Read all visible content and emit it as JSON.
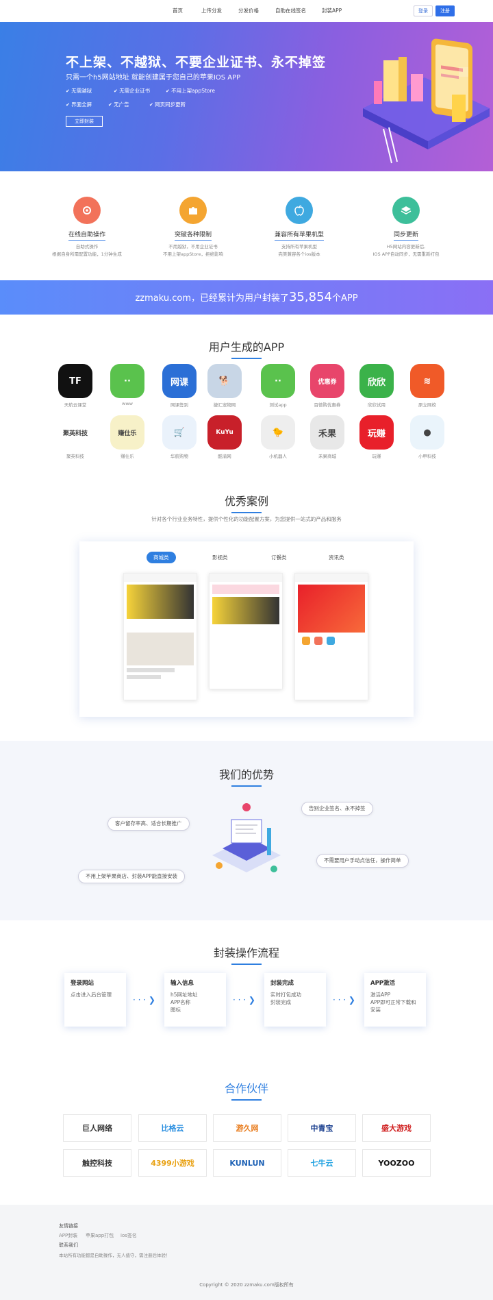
{
  "nav": {
    "links": [
      "首页",
      "上传分发",
      "分发价格",
      "自助在线签名",
      "封装APP"
    ],
    "login": "登录",
    "register": "注册"
  },
  "hero": {
    "title": "不上架、不越狱、不要企业证书、永不掉签",
    "subtitle": "只需一个h5网站地址 就能创建属于您自己的苹果IOS APP",
    "features": [
      "无需越狱",
      "无需企业证书",
      "不用上架appStore",
      "界面全屏",
      "无广告",
      "网页同步更新"
    ],
    "button": "立即封装"
  },
  "features": [
    {
      "title": "在线自助操作",
      "desc1": "自助式操作",
      "desc2": "根据自身所需配置功能，1分钟生成",
      "color": "#f2725a",
      "icon": "gear-icon"
    },
    {
      "title": "突破各种限制",
      "desc1": "不用越狱，不用企业证书",
      "desc2": "不用上架appStore，拒绝影响",
      "color": "#f4a531",
      "icon": "puzzle-icon"
    },
    {
      "title": "兼容所有苹果机型",
      "desc1": "支持所有苹果机型",
      "desc2": "完美兼容各个ios版本",
      "color": "#3fa9e0",
      "icon": "apple-icon"
    },
    {
      "title": "同步更新",
      "desc1": "H5网站内容更新后,",
      "desc2": "IOS APP自动同步，无需重新打包",
      "color": "#3dbf9a",
      "icon": "layers-icon"
    }
  ],
  "banner": {
    "prefix": "zzmaku.com，已经累计为用户封装了",
    "count": "35,854",
    "suffix": "个APP"
  },
  "apps_section": {
    "title": "用户生成的APP",
    "apps": [
      {
        "name": "天航云课堂",
        "text": "TF",
        "bg": "#111"
      },
      {
        "name": "www",
        "text": "··",
        "bg": "#5ac24d"
      },
      {
        "name": "网课签到",
        "text": "网课",
        "bg": "#2b6fd6"
      },
      {
        "name": "捷汇宠物网",
        "text": "🐕",
        "bg": "#c8d6e6"
      },
      {
        "name": "测试app",
        "text": "··",
        "bg": "#5ac24d"
      },
      {
        "name": "百德购优惠券",
        "text": "优惠券",
        "bg": "#e8456b"
      },
      {
        "name": "欣欣试用",
        "text": "欣欣",
        "bg": "#3bb24a"
      },
      {
        "name": "原立网校",
        "text": "≋",
        "bg": "#f05a28"
      },
      {
        "name": "聚英科技",
        "text": "聚英科技",
        "bg": "#fff"
      },
      {
        "name": "赚仕乐",
        "text": "赚仕乐",
        "bg": "#f7f1c8"
      },
      {
        "name": "华航购物",
        "text": "🛒",
        "bg": "#eaf2fb"
      },
      {
        "name": "酷渝网",
        "text": "KuYu",
        "bg": "#c8202a"
      },
      {
        "name": "小机器人",
        "text": "🐤",
        "bg": "#eeeeee"
      },
      {
        "name": "禾果商城",
        "text": "禾果",
        "bg": "#e8e8e8"
      },
      {
        "name": "玩赚",
        "text": "玩赚",
        "bg": "#e8202a"
      },
      {
        "name": "小甲科技",
        "text": "●",
        "bg": "#eaf4fb"
      }
    ]
  },
  "cases": {
    "title": "优秀案例",
    "subtitle": "针对各个行业业务特性，提供个性化的功能配置方案，为您提供一站式的产品和服务",
    "tabs": [
      "商城类",
      "影视类",
      "订餐类",
      "资讯类"
    ]
  },
  "advantages": {
    "title": "我们的优势",
    "items": [
      "告别企业签名、永不掉签",
      "客户留存率高、适合长期推广",
      "不需要用户手动点信任，操作简单",
      "不用上架苹果商店、封装APP能直接安装"
    ]
  },
  "process": {
    "title": "封装操作流程",
    "steps": [
      {
        "title": "登录网站",
        "lines": [
          "点击进入后台管理"
        ]
      },
      {
        "title": "输入信息",
        "lines": [
          "h5网址地址",
          "APP名称",
          "图标"
        ]
      },
      {
        "title": "封装完成",
        "lines": [
          "实时打包成功",
          "封装完成"
        ]
      },
      {
        "title": "APP激活",
        "lines": [
          "激活APP",
          "APP即可正常下载和安装"
        ]
      }
    ]
  },
  "partners": {
    "title": "合作伙伴",
    "items": [
      {
        "name": "巨人网络",
        "color": "#333"
      },
      {
        "name": "比格云",
        "color": "#2b8fe0"
      },
      {
        "name": "游久网",
        "color": "#e87a1a"
      },
      {
        "name": "中青宝",
        "color": "#1a3f8f"
      },
      {
        "name": "盛大游戏",
        "color": "#d02020"
      },
      {
        "name": "触控科技",
        "color": "#333"
      },
      {
        "name": "4399小游戏",
        "color": "#e8a010"
      },
      {
        "name": "KUNLUN",
        "color": "#1a5fb4"
      },
      {
        "name": "七牛云",
        "color": "#1a9fe0"
      },
      {
        "name": "YOOZOO",
        "color": "#111"
      }
    ]
  },
  "footer": {
    "links_title": "友情链接",
    "links": [
      "APP封装",
      "苹果app打包",
      "ios签名"
    ],
    "contact_title": "联系我们",
    "note": "本站所有功能都是自助操作，无人值守，需注册后体验！",
    "copyright": "Copyright © 2020 zzmaku.com版权所有"
  }
}
